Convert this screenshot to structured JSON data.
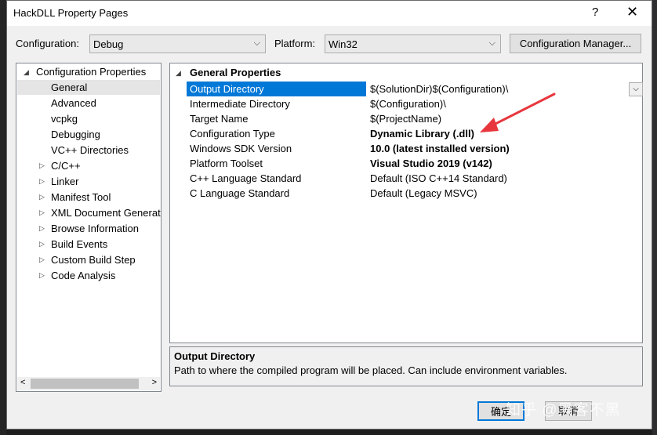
{
  "window": {
    "title": "HackDLL Property Pages",
    "help_glyph": "?",
    "close_glyph": "✕"
  },
  "config_bar": {
    "configuration_label": "Configuration:",
    "configuration_value": "Debug",
    "platform_label": "Platform:",
    "platform_value": "Win32",
    "config_manager_button": "Configuration Manager..."
  },
  "tree": {
    "root": {
      "label": "Configuration Properties",
      "expander": "◢"
    },
    "items": [
      {
        "label": "General",
        "selected": true,
        "expandable": false
      },
      {
        "label": "Advanced",
        "expandable": false
      },
      {
        "label": "vcpkg",
        "expandable": false
      },
      {
        "label": "Debugging",
        "expandable": false
      },
      {
        "label": "VC++ Directories",
        "expandable": false
      },
      {
        "label": "C/C++",
        "expandable": true
      },
      {
        "label": "Linker",
        "expandable": true
      },
      {
        "label": "Manifest Tool",
        "expandable": true
      },
      {
        "label": "XML Document Generat",
        "expandable": true
      },
      {
        "label": "Browse Information",
        "expandable": true
      },
      {
        "label": "Build Events",
        "expandable": true
      },
      {
        "label": "Custom Build Step",
        "expandable": true
      },
      {
        "label": "Code Analysis",
        "expandable": true
      }
    ],
    "scroll_left": "<",
    "scroll_right": ">"
  },
  "grid": {
    "section_title": "General Properties",
    "rows": [
      {
        "key": "Output Directory",
        "value": "$(SolutionDir)$(Configuration)\\",
        "selected": true
      },
      {
        "key": "Intermediate Directory",
        "value": "$(Configuration)\\"
      },
      {
        "key": "Target Name",
        "value": "$(ProjectName)"
      },
      {
        "key": "Configuration Type",
        "value": "Dynamic Library (.dll)",
        "bold": true
      },
      {
        "key": "Windows SDK Version",
        "value": "10.0 (latest installed version)",
        "bold": true
      },
      {
        "key": "Platform Toolset",
        "value": "Visual Studio 2019 (v142)",
        "bold": true
      },
      {
        "key": "C++ Language Standard",
        "value": "Default (ISO C++14 Standard)"
      },
      {
        "key": "C Language Standard",
        "value": "Default (Legacy MSVC)"
      }
    ]
  },
  "description": {
    "title": "Output Directory",
    "text": "Path to where the compiled program will be placed. Can include environment variables."
  },
  "footer": {
    "ok_button": "确定",
    "cancel_button": "取消"
  },
  "watermark": "知乎 @黑客不黑",
  "colors": {
    "selection": "#0078d7",
    "annotation_arrow": "#e8363d"
  }
}
